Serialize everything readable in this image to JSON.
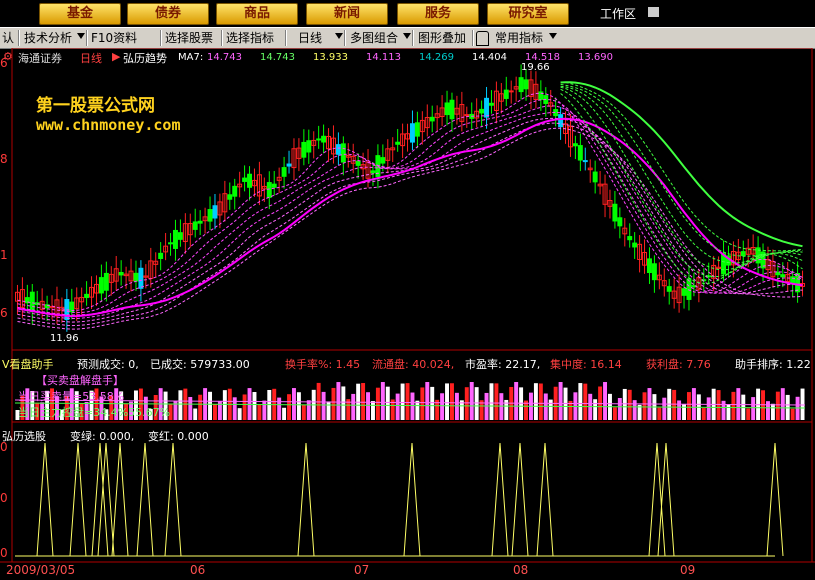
{
  "top_menu": {
    "items": [
      "基金",
      "债券",
      "商品",
      "新闻",
      "服务",
      "研究室"
    ],
    "workspace": "工作区"
  },
  "toolbar": {
    "items": [
      "认",
      "技术分析",
      "F10资料",
      "选择股票",
      "选择指标",
      "日线",
      "多图组合",
      "图形叠加",
      "常用指标"
    ]
  },
  "main_header": {
    "broker": "海通证券",
    "period": "日线",
    "indicator": "弘历趋势",
    "ma_label": "MA7:",
    "ma_values": [
      "14.743",
      "14.743",
      "13.933",
      "14.113",
      "14.269",
      "14.404",
      "14.518",
      "13.690"
    ]
  },
  "watermark": {
    "line1": "第一股票公式网",
    "line2": "www.chnmoney.com"
  },
  "price_labels": {
    "high": "19.66",
    "low": "11.96"
  },
  "y_axis": [
    "6",
    "8",
    "1",
    "6"
  ],
  "vol_header": {
    "title": "V看盘助手",
    "predict": "预测成交: 0,",
    "done": "已成交: 579733.00",
    "turnover": "换手率%: 1.45",
    "float": "流通盘: 40.024,",
    "pe": "市盈率: 22.17,",
    "conc": "集中度: 16.14",
    "profit": "获利盘: 7.76",
    "rank": "助手排序: 1.22",
    "sub1": "【买卖盘解盘手】",
    "sub2": "当日买卖量=53.58%",
    "sub3": "当日主力控盘=34.4%55.67%"
  },
  "sel_header": {
    "title": "弘历选股",
    "green": "变绿: 0.000,",
    "red": "变红: 0.000"
  },
  "sel_y": [
    "0",
    "0",
    "0"
  ],
  "x_axis": [
    "2009/03/05",
    "06",
    "07",
    "08",
    "09"
  ],
  "colors": {
    "up": "#ff2020",
    "down": "#00ff00",
    "ma": "#ff00ff",
    "long": "#40ff40",
    "signal": "#ffff66",
    "axis": "#b00000"
  },
  "chart_data": {
    "type": "line",
    "x": [
      "2009/03/05",
      "06",
      "07",
      "08",
      "09"
    ],
    "close_samples": [
      12.4,
      12.1,
      11.96,
      12.6,
      13.2,
      13.0,
      14.2,
      14.8,
      15.4,
      16.4,
      16.0,
      17.2,
      17.8,
      17.2,
      16.6,
      17.6,
      18.2,
      18.8,
      18.5,
      19.1,
      19.66,
      19.0,
      17.6,
      16.2,
      14.6,
      13.4,
      12.4,
      12.9,
      13.6,
      14.0,
      13.2,
      12.8
    ],
    "high": 19.66,
    "low": 11.96
  }
}
